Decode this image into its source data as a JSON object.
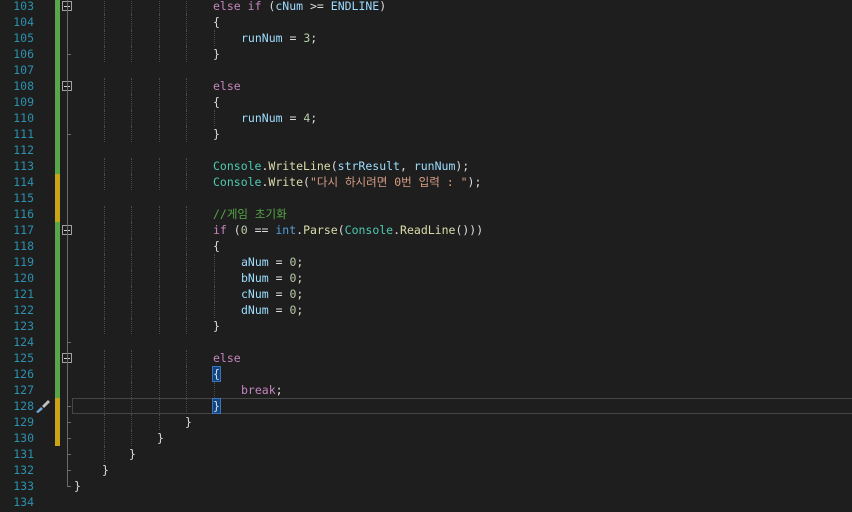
{
  "editor": {
    "lines": [
      {
        "n": "103",
        "indent": 5,
        "change": "green",
        "fold": true,
        "tokens": [
          [
            "kw",
            "else"
          ],
          [
            "pn",
            " "
          ],
          [
            "kw",
            "if"
          ],
          [
            "pn",
            " ("
          ],
          [
            "id",
            "cNum"
          ],
          [
            "pn",
            " >= "
          ],
          [
            "id",
            "ENDLINE"
          ],
          [
            "pn",
            ")"
          ]
        ]
      },
      {
        "n": "104",
        "indent": 5,
        "change": "green",
        "fold": false,
        "tokens": [
          [
            "pn",
            "{"
          ]
        ]
      },
      {
        "n": "105",
        "indent": 6,
        "change": "green",
        "fold": false,
        "tokens": [
          [
            "id",
            "runNum"
          ],
          [
            "pn",
            " = "
          ],
          [
            "num",
            "3"
          ],
          [
            "pn",
            ";"
          ]
        ]
      },
      {
        "n": "106",
        "indent": 5,
        "change": "green",
        "fold": false,
        "tokens": [
          [
            "pn",
            "}"
          ]
        ]
      },
      {
        "n": "107",
        "indent": 0,
        "change": "green",
        "fold": false,
        "tokens": []
      },
      {
        "n": "108",
        "indent": 5,
        "change": "green",
        "fold": true,
        "tokens": [
          [
            "kw",
            "else"
          ]
        ]
      },
      {
        "n": "109",
        "indent": 5,
        "change": "green",
        "fold": false,
        "tokens": [
          [
            "pn",
            "{"
          ]
        ]
      },
      {
        "n": "110",
        "indent": 6,
        "change": "green",
        "fold": false,
        "tokens": [
          [
            "id",
            "runNum"
          ],
          [
            "pn",
            " = "
          ],
          [
            "num",
            "4"
          ],
          [
            "pn",
            ";"
          ]
        ]
      },
      {
        "n": "111",
        "indent": 5,
        "change": "green",
        "fold": false,
        "tokens": [
          [
            "pn",
            "}"
          ]
        ]
      },
      {
        "n": "112",
        "indent": 0,
        "change": "green",
        "fold": false,
        "tokens": []
      },
      {
        "n": "113",
        "indent": 5,
        "change": "green",
        "fold": false,
        "tokens": [
          [
            "ty",
            "Console"
          ],
          [
            "pn",
            "."
          ],
          [
            "fn",
            "WriteLine"
          ],
          [
            "pn",
            "("
          ],
          [
            "id",
            "strResult"
          ],
          [
            "pn",
            ", "
          ],
          [
            "id",
            "runNum"
          ],
          [
            "pn",
            ");"
          ]
        ]
      },
      {
        "n": "114",
        "indent": 5,
        "change": "yellow",
        "fold": false,
        "tokens": [
          [
            "ty",
            "Console"
          ],
          [
            "pn",
            "."
          ],
          [
            "fn",
            "Write"
          ],
          [
            "pn",
            "("
          ],
          [
            "str",
            "\"다시 하시려면 0번 입력 : \""
          ],
          [
            "pn",
            ");"
          ]
        ]
      },
      {
        "n": "115",
        "indent": 0,
        "change": "yellow",
        "fold": false,
        "tokens": []
      },
      {
        "n": "116",
        "indent": 5,
        "change": "yellow",
        "fold": false,
        "tokens": [
          [
            "cm",
            "//게임 초기화"
          ]
        ]
      },
      {
        "n": "117",
        "indent": 5,
        "change": "green",
        "fold": true,
        "tokens": [
          [
            "kw",
            "if"
          ],
          [
            "pn",
            " ("
          ],
          [
            "num",
            "0"
          ],
          [
            "pn",
            " == "
          ],
          [
            "kwb",
            "int"
          ],
          [
            "pn",
            "."
          ],
          [
            "fn",
            "Parse"
          ],
          [
            "pn",
            "("
          ],
          [
            "ty",
            "Console"
          ],
          [
            "pn",
            "."
          ],
          [
            "fn",
            "ReadLine"
          ],
          [
            "pn",
            "()))"
          ]
        ]
      },
      {
        "n": "118",
        "indent": 5,
        "change": "green",
        "fold": false,
        "tokens": [
          [
            "pn",
            "{"
          ]
        ]
      },
      {
        "n": "119",
        "indent": 6,
        "change": "green",
        "fold": false,
        "tokens": [
          [
            "id",
            "aNum"
          ],
          [
            "pn",
            " = "
          ],
          [
            "num",
            "0"
          ],
          [
            "pn",
            ";"
          ]
        ]
      },
      {
        "n": "120",
        "indent": 6,
        "change": "green",
        "fold": false,
        "tokens": [
          [
            "id",
            "bNum"
          ],
          [
            "pn",
            " = "
          ],
          [
            "num",
            "0"
          ],
          [
            "pn",
            ";"
          ]
        ]
      },
      {
        "n": "121",
        "indent": 6,
        "change": "green",
        "fold": false,
        "tokens": [
          [
            "id",
            "cNum"
          ],
          [
            "pn",
            " = "
          ],
          [
            "num",
            "0"
          ],
          [
            "pn",
            ";"
          ]
        ]
      },
      {
        "n": "122",
        "indent": 6,
        "change": "green",
        "fold": false,
        "tokens": [
          [
            "id",
            "dNum"
          ],
          [
            "pn",
            " = "
          ],
          [
            "num",
            "0"
          ],
          [
            "pn",
            ";"
          ]
        ]
      },
      {
        "n": "123",
        "indent": 5,
        "change": "green",
        "fold": false,
        "tokens": [
          [
            "pn",
            "}"
          ]
        ]
      },
      {
        "n": "124",
        "indent": 0,
        "change": "green",
        "fold": false,
        "tokens": []
      },
      {
        "n": "125",
        "indent": 5,
        "change": "green",
        "fold": true,
        "tokens": [
          [
            "kw",
            "else"
          ]
        ]
      },
      {
        "n": "126",
        "indent": 5,
        "change": "green",
        "fold": false,
        "tokens": [
          [
            "hl",
            "{"
          ]
        ]
      },
      {
        "n": "127",
        "indent": 6,
        "change": "green",
        "fold": false,
        "tokens": [
          [
            "kw",
            "break"
          ],
          [
            "pn",
            ";"
          ]
        ]
      },
      {
        "n": "128",
        "indent": 5,
        "change": "yellow",
        "fold": false,
        "current": true,
        "tokens": [
          [
            "hl",
            "}"
          ],
          [
            "caret",
            ""
          ]
        ]
      },
      {
        "n": "129",
        "indent": 4,
        "change": "yellow",
        "fold": false,
        "tokens": [
          [
            "pn",
            "}"
          ]
        ]
      },
      {
        "n": "130",
        "indent": 3,
        "change": "yellow",
        "fold": false,
        "tokens": [
          [
            "pn",
            "}"
          ]
        ]
      },
      {
        "n": "131",
        "indent": 2,
        "change": "none",
        "fold": false,
        "tokens": [
          [
            "pn",
            "}"
          ]
        ]
      },
      {
        "n": "132",
        "indent": 1,
        "change": "none",
        "fold": false,
        "tokens": [
          [
            "pn",
            "}"
          ]
        ]
      },
      {
        "n": "133",
        "indent": 0,
        "change": "none",
        "fold": false,
        "tokens": [
          [
            "pn",
            "}"
          ]
        ]
      },
      {
        "n": "134",
        "indent": 0,
        "change": "none",
        "fold": false,
        "tokens": []
      }
    ],
    "colors": {
      "green": "#57a64a",
      "yellow": "#c8a416",
      "background": "#1e1e1e",
      "line_number": "#2b91af"
    },
    "margin_icon": "brush-icon"
  }
}
